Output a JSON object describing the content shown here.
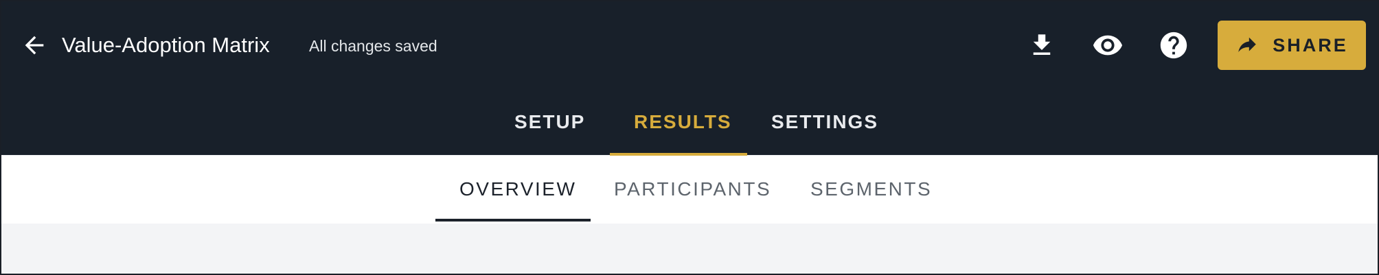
{
  "header": {
    "title": "Value-Adoption Matrix",
    "save_status": "All changes saved",
    "share_label": "SHARE",
    "icons": [
      "arrow-back-icon",
      "download-icon",
      "eye-icon",
      "help-icon",
      "share-arrow-icon"
    ]
  },
  "main_tabs": [
    {
      "label": "SETUP",
      "active": false
    },
    {
      "label": "RESULTS",
      "active": true
    },
    {
      "label": "SETTINGS",
      "active": false
    }
  ],
  "sub_tabs": [
    {
      "label": "OVERVIEW",
      "active": true
    },
    {
      "label": "PARTICIPANTS",
      "active": false
    },
    {
      "label": "SEGMENTS",
      "active": false
    }
  ],
  "colors": {
    "header_bg": "#18202a",
    "accent": "#d7ac3c",
    "subbar_bg": "#ffffff",
    "content_bg": "#f3f4f6"
  }
}
